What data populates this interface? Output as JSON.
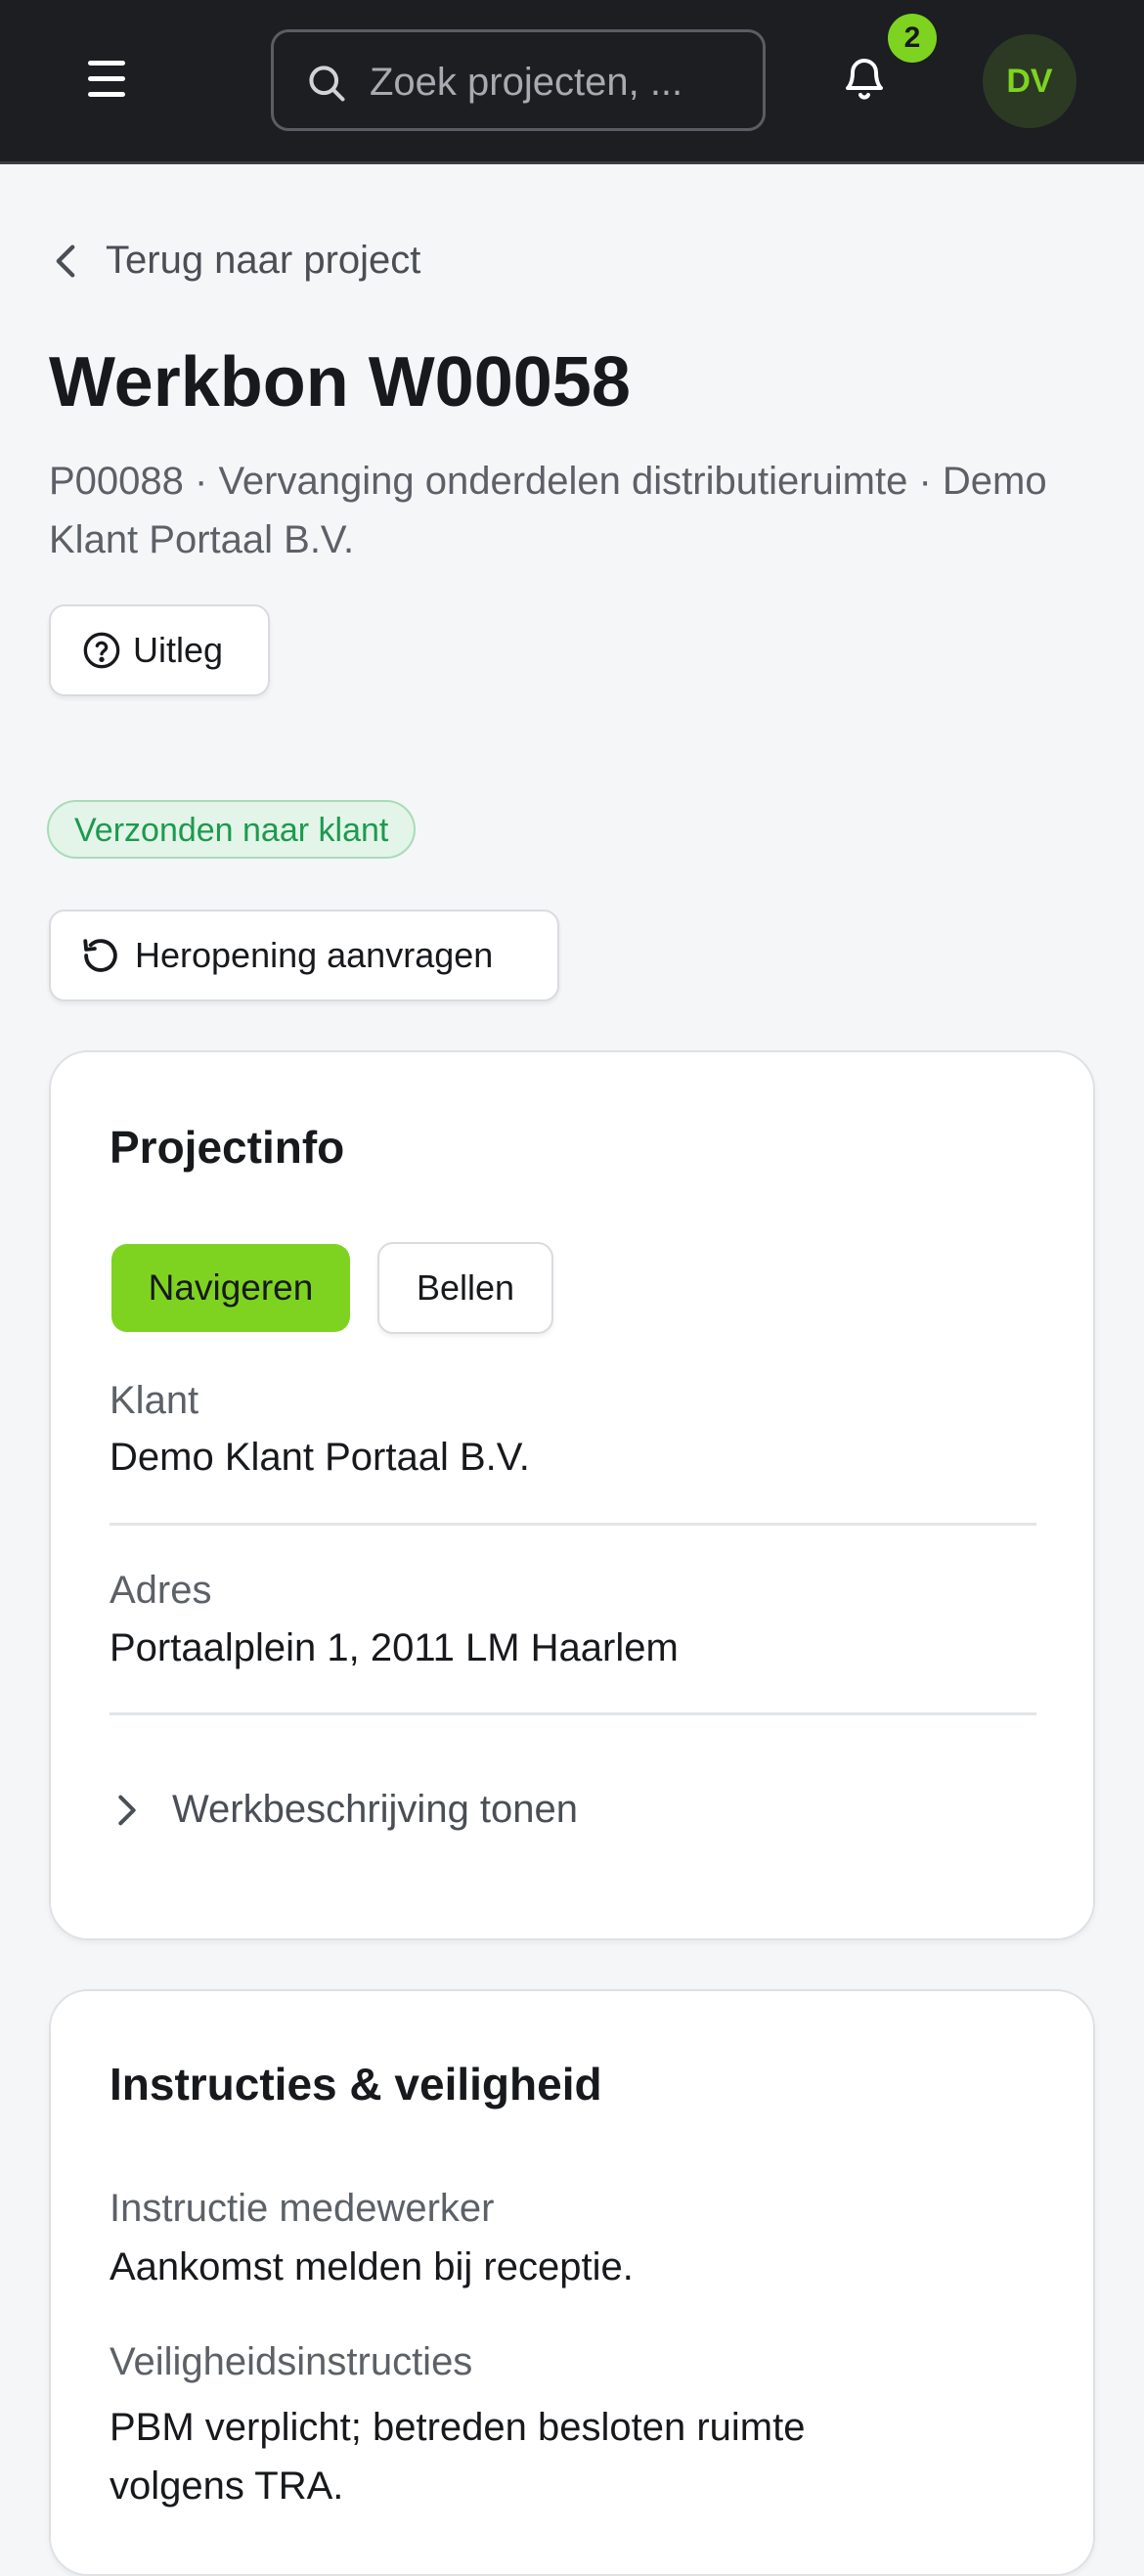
{
  "header": {
    "search_placeholder": "Zoek projecten, ...",
    "notification_count": "2",
    "avatar_initials": "DV",
    "accent_color": "#7ed321"
  },
  "page": {
    "back_label": "Terug naar project",
    "title": "Werkbon W00058",
    "subtitle": "P00088 · Vervanging onderdelen distributieruimte · Demo Klant Portaal B.V.",
    "explain_button": "Uitleg",
    "status_badge": "Verzonden naar klant",
    "reopen_button": "Heropening aanvragen"
  },
  "project_info": {
    "heading": "Projectinfo",
    "navigate_button": "Navigeren",
    "call_button": "Bellen",
    "client_label": "Klant",
    "client_value": "Demo Klant Portaal B.V.",
    "address_label": "Adres",
    "address_value": "Portaalplein 1, 2011 LM Haarlem",
    "description_toggle": "Werkbeschrijving tonen"
  },
  "instructions": {
    "heading": "Instructies & veiligheid",
    "employee_label": "Instructie medewerker",
    "employee_value": "Aankomst melden bij receptie.",
    "safety_label": "Veiligheidsinstructies",
    "safety_value": "PBM verplicht; betreden besloten ruimte volgens TRA."
  }
}
